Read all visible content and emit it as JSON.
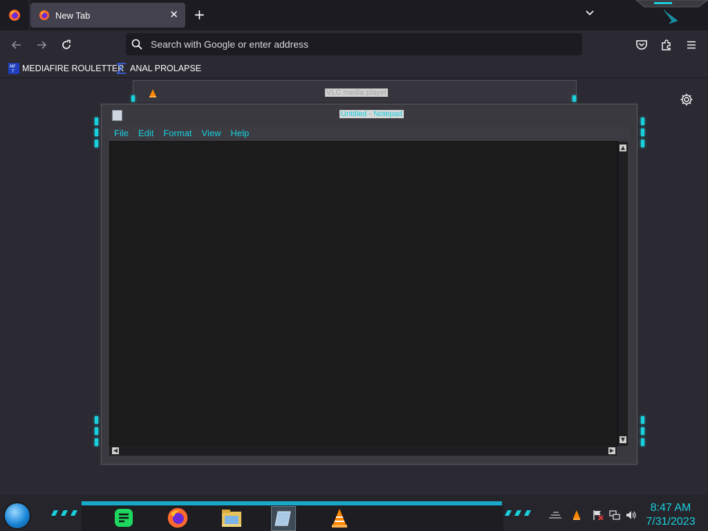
{
  "browser": {
    "tab_title": "New Tab",
    "new_tab_symbol": "+",
    "close_symbol": "✕",
    "search_placeholder": "Search with Google or enter address",
    "bookmarks": [
      {
        "label": "MEDIAFIRE ROULETTER",
        "icon": "mediafire-icon",
        "icon_text": "MF\nT"
      },
      {
        "label": "ANAL PROLAPSE",
        "icon": "sigma-icon"
      }
    ]
  },
  "windows": {
    "vlc_title": "VLC media player",
    "notepad_title": "Untitled - Notepad",
    "notepad_menu": [
      "File",
      "Edit",
      "Format",
      "View",
      "Help"
    ],
    "notepad_text": ""
  },
  "taskbar": {
    "time": "8:47 AM",
    "date": "7/31/2023",
    "apps": [
      "notes-app-icon",
      "firefox-icon",
      "file-explorer-icon",
      "notepad-icon",
      "vlc-icon"
    ]
  },
  "colors": {
    "accent": "#19d0dd",
    "chrome_dark": "#1c1b22",
    "chrome": "#2b2a33",
    "tab_active": "#42414d"
  }
}
